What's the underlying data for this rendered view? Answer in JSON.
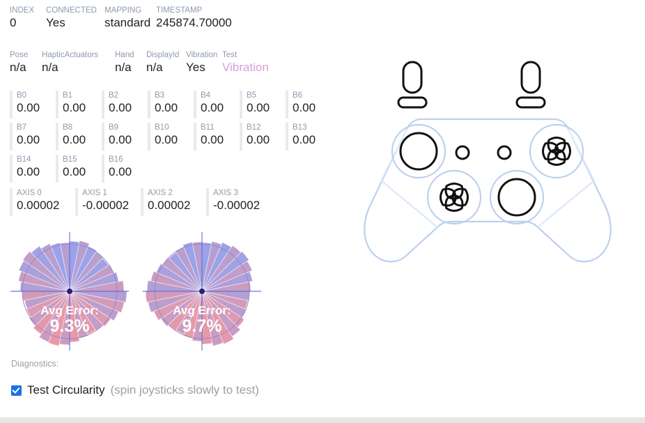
{
  "status_row": [
    {
      "label": "INDEX",
      "value": "0"
    },
    {
      "label": "CONNECTED",
      "value": "Yes"
    },
    {
      "label": "MAPPING",
      "value": "standard"
    },
    {
      "label": "TIMESTAMP",
      "value": "245874.70000"
    }
  ],
  "feature_row": [
    {
      "label": "Pose",
      "value": "n/a"
    },
    {
      "label": "HapticActuators",
      "value": "n/a"
    },
    {
      "label": "Hand",
      "value": "n/a"
    },
    {
      "label": "DisplayId",
      "value": "n/a"
    },
    {
      "label": "Vibration",
      "value": "Yes"
    },
    {
      "label": "Test",
      "value": "Vibration",
      "is_link": true
    }
  ],
  "buttons": [
    {
      "label": "B0",
      "value": "0.00"
    },
    {
      "label": "B1",
      "value": "0.00"
    },
    {
      "label": "B2",
      "value": "0.00"
    },
    {
      "label": "B3",
      "value": "0.00"
    },
    {
      "label": "B4",
      "value": "0.00"
    },
    {
      "label": "B5",
      "value": "0.00"
    },
    {
      "label": "B6",
      "value": "0.00"
    },
    {
      "label": "B7",
      "value": "0.00"
    },
    {
      "label": "B8",
      "value": "0.00"
    },
    {
      "label": "B9",
      "value": "0.00"
    },
    {
      "label": "B10",
      "value": "0.00"
    },
    {
      "label": "B11",
      "value": "0.00"
    },
    {
      "label": "B12",
      "value": "0.00"
    },
    {
      "label": "B13",
      "value": "0.00"
    },
    {
      "label": "B14",
      "value": "0.00"
    },
    {
      "label": "B15",
      "value": "0.00"
    },
    {
      "label": "B16",
      "value": "0.00"
    }
  ],
  "axes": [
    {
      "label": "AXIS 0",
      "value": "0.00002"
    },
    {
      "label": "AXIS 1",
      "value": "-0.00002"
    },
    {
      "label": "AXIS 2",
      "value": "0.00002"
    },
    {
      "label": "AXIS 3",
      "value": "-0.00002"
    }
  ],
  "diagnostics": {
    "heading": "Diagnostics:",
    "checkbox_checked": true,
    "checkbox_label": "Test Circularity",
    "checkbox_hint": "(spin joysticks slowly to test)"
  },
  "colors": {
    "label": "#8e99ad",
    "value": "#202124",
    "link": "#d69fdb",
    "accent": "#1a73e8",
    "gamepad_body": "#bcd0ee",
    "gamepad_button": "#111111",
    "chart_blue": "#6a7fe8",
    "chart_red": "#e8707f",
    "chart_ring": "#9a86c8",
    "chart_center": "#2a1f7a",
    "bar_track": "#e8eaed",
    "scrollbar": "#e6e6e6"
  },
  "gamepad": {
    "icon": "gamepad-diagram",
    "shoulder_buttons": [
      "L1",
      "R1"
    ],
    "triggers": [
      "L2",
      "R2"
    ],
    "sticks": [
      "left-stick",
      "right-stick"
    ],
    "dpads": [
      "dpad-right-cluster",
      "dpad-left-cluster"
    ],
    "center_buttons": [
      "select",
      "start"
    ]
  },
  "chart_data": [
    {
      "type": "pie",
      "name": "left-stick-circularity",
      "title": "Avg Error:",
      "value_label": "9.3%",
      "avg_error_percent": 9.3,
      "units": "percent",
      "segments": 32,
      "reference_radius": 68,
      "radii": [
        72,
        74,
        70,
        68,
        67,
        69,
        72,
        78,
        82,
        80,
        76,
        71,
        68,
        67,
        69,
        73,
        77,
        80,
        79,
        74,
        70,
        67,
        66,
        68,
        71,
        75,
        79,
        81,
        78,
        74,
        71,
        70
      ],
      "note": "Polar plot of joystick sweep radius vs ideal circle"
    },
    {
      "type": "pie",
      "name": "right-stick-circularity",
      "title": "Avg Error:",
      "value_label": "9.7%",
      "avg_error_percent": 9.7,
      "units": "percent",
      "segments": 32,
      "reference_radius": 68,
      "radii": [
        70,
        73,
        76,
        79,
        81,
        78,
        74,
        70,
        68,
        67,
        69,
        73,
        78,
        82,
        80,
        76,
        72,
        69,
        67,
        68,
        71,
        75,
        79,
        81,
        79,
        75,
        71,
        68,
        67,
        69,
        72,
        71
      ],
      "note": "Polar plot of joystick sweep radius vs ideal circle"
    }
  ]
}
